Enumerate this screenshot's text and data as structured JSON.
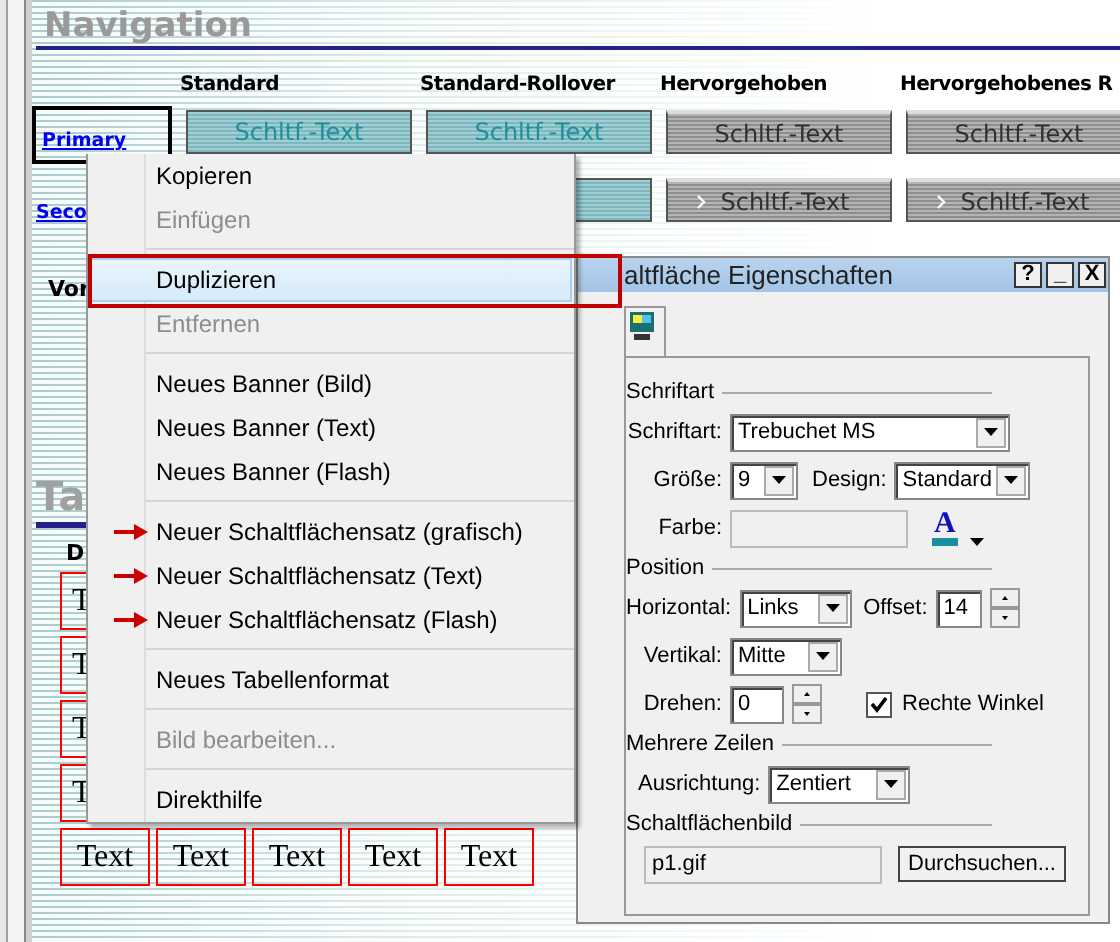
{
  "page": {
    "heading": "Navigation",
    "columns": [
      "Standard",
      "Standard-Rollover",
      "Hervorgehoben",
      "Hervorgehobenes R"
    ],
    "rows": [
      {
        "label": "Primary",
        "selected": true,
        "arrow": false,
        "buttons": [
          {
            "kind": "teal",
            "label": "Schltf.-Text"
          },
          {
            "kind": "teal",
            "label": "Schltf.-Text"
          },
          {
            "kind": "gray",
            "label": "Schltf.-Text"
          },
          {
            "kind": "gray",
            "label": "Schltf.-Text"
          }
        ]
      },
      {
        "label": "Seco",
        "selected": false,
        "arrow": true,
        "buttons": [
          {
            "kind": "teal"
          },
          {
            "kind": "gray",
            "label": "Schltf.-Text"
          },
          {
            "kind": "gray",
            "label": "Schltf.-Text"
          }
        ]
      }
    ],
    "note": "Vor",
    "section_heading": "Ta",
    "table_header": "D",
    "table_rows": [
      [
        "T"
      ],
      [
        "T"
      ],
      [
        "T"
      ],
      [
        "T"
      ],
      [
        "Text",
        "Text",
        "Text",
        "Text",
        "Text"
      ]
    ]
  },
  "context_menu": [
    {
      "kind": "item",
      "label": "Kopieren",
      "disabled": false,
      "selected": false,
      "arrow": false
    },
    {
      "kind": "item",
      "label": "Einfügen",
      "disabled": true,
      "selected": false,
      "arrow": false
    },
    {
      "kind": "separator"
    },
    {
      "kind": "item",
      "label": "Duplizieren",
      "disabled": false,
      "selected": true,
      "arrow": false
    },
    {
      "kind": "item",
      "label": "Entfernen",
      "disabled": true,
      "selected": false,
      "arrow": false
    },
    {
      "kind": "separator"
    },
    {
      "kind": "item",
      "label": "Neues Banner (Bild)",
      "disabled": false,
      "selected": false,
      "arrow": false
    },
    {
      "kind": "item",
      "label": "Neues Banner (Text)",
      "disabled": false,
      "selected": false,
      "arrow": false
    },
    {
      "kind": "item",
      "label": "Neues Banner (Flash)",
      "disabled": false,
      "selected": false,
      "arrow": false
    },
    {
      "kind": "separator"
    },
    {
      "kind": "item",
      "label": "Neuer Schaltflächensatz (grafisch)",
      "disabled": false,
      "selected": false,
      "arrow": true
    },
    {
      "kind": "item",
      "label": "Neuer Schaltflächensatz (Text)",
      "disabled": false,
      "selected": false,
      "arrow": true
    },
    {
      "kind": "item",
      "label": "Neuer Schaltflächensatz (Flash)",
      "disabled": false,
      "selected": false,
      "arrow": true
    },
    {
      "kind": "separator"
    },
    {
      "kind": "item",
      "label": "Neues Tabellenformat",
      "disabled": false,
      "selected": false,
      "arrow": false
    },
    {
      "kind": "separator"
    },
    {
      "kind": "item",
      "label": "Bild bearbeiten...",
      "disabled": true,
      "selected": false,
      "arrow": false
    },
    {
      "kind": "separator"
    },
    {
      "kind": "item",
      "label": "Direkthilfe",
      "disabled": false,
      "selected": false,
      "arrow": false
    }
  ],
  "dialog": {
    "title": "altfläche Eigenschaften",
    "title_buttons": [
      "?",
      "_",
      "X"
    ],
    "groups": [
      {
        "legend": "Schriftart",
        "rows": [
          [
            {
              "kind": "combo",
              "label": "Schriftart:",
              "value": "Trebuchet MS"
            }
          ],
          [
            {
              "kind": "combo",
              "label": "Größe:",
              "value": "9"
            },
            {
              "kind": "combo",
              "label": "Design:",
              "value": "Standard"
            }
          ],
          [
            {
              "kind": "field",
              "label": "Farbe:",
              "disabled": true
            },
            {
              "kind": "color",
              "glyph": "A"
            }
          ]
        ]
      },
      {
        "legend": "Position",
        "rows": [
          [
            {
              "kind": "combo",
              "label": "Horizontal:",
              "value": "Links"
            },
            {
              "kind": "spin",
              "label": "Offset:",
              "value": "14"
            }
          ],
          [
            {
              "kind": "combo",
              "label": "Vertikal:",
              "value": "Mitte"
            }
          ],
          [
            {
              "kind": "spin",
              "label": "Drehen:",
              "value": "0"
            },
            {
              "kind": "checkbox",
              "label": "Rechte Winkel",
              "checked": true
            }
          ]
        ]
      },
      {
        "legend": "Mehrere Zeilen",
        "rows": [
          [
            {
              "kind": "combo",
              "label": "Ausrichtung:",
              "value": "Zentiert"
            }
          ]
        ]
      },
      {
        "legend": "Schaltflächenbild",
        "rows": [
          [
            {
              "kind": "field",
              "value": "p1.gif",
              "disabled": true
            },
            {
              "kind": "button",
              "label": "Durchsuchen..."
            }
          ]
        ]
      }
    ]
  }
}
